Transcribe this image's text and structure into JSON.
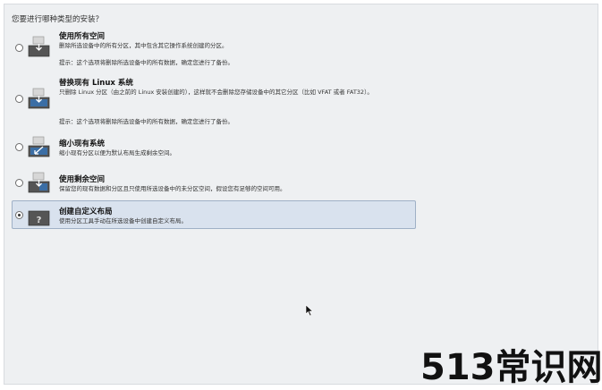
{
  "question": "您要进行哪种类型的安装？",
  "options": [
    {
      "title": "使用所有空间",
      "desc": "删除所选设备中的所有分区，其中包含其它操作系统创建的分区。",
      "note": "提示：这个选项将删除所选设备中的所有数据，确定您进行了备份。",
      "selected": false
    },
    {
      "title": "替换现有 Linux 系统",
      "desc": "只删除 Linux 分区（由之前的 Linux 安装创建的），这样就不会删除您存储设备中的其它分区（比如 VFAT 或者 FAT32）。",
      "note": "提示：这个选项将删除所选设备中的所有数据，确定您进行了备份。",
      "selected": false
    },
    {
      "title": "缩小现有系统",
      "desc": "缩小现有分区以便为默认布局生成剩余空间。",
      "selected": false
    },
    {
      "title": "使用剩余空间",
      "desc": "保留您的现有数据和分区且只使用所选设备中的未分区空间，假设您有足够的空间可用。",
      "selected": false
    },
    {
      "title": "创建自定义布局",
      "desc": "使用分区工具手动在所选设备中创建自定义布局。",
      "selected": true
    }
  ],
  "watermark": "513常识网",
  "colors": {
    "panel_bg": "#eef0f2",
    "selected_bg": "#d9e2ee",
    "icon_blue": "#3b6ea5"
  }
}
